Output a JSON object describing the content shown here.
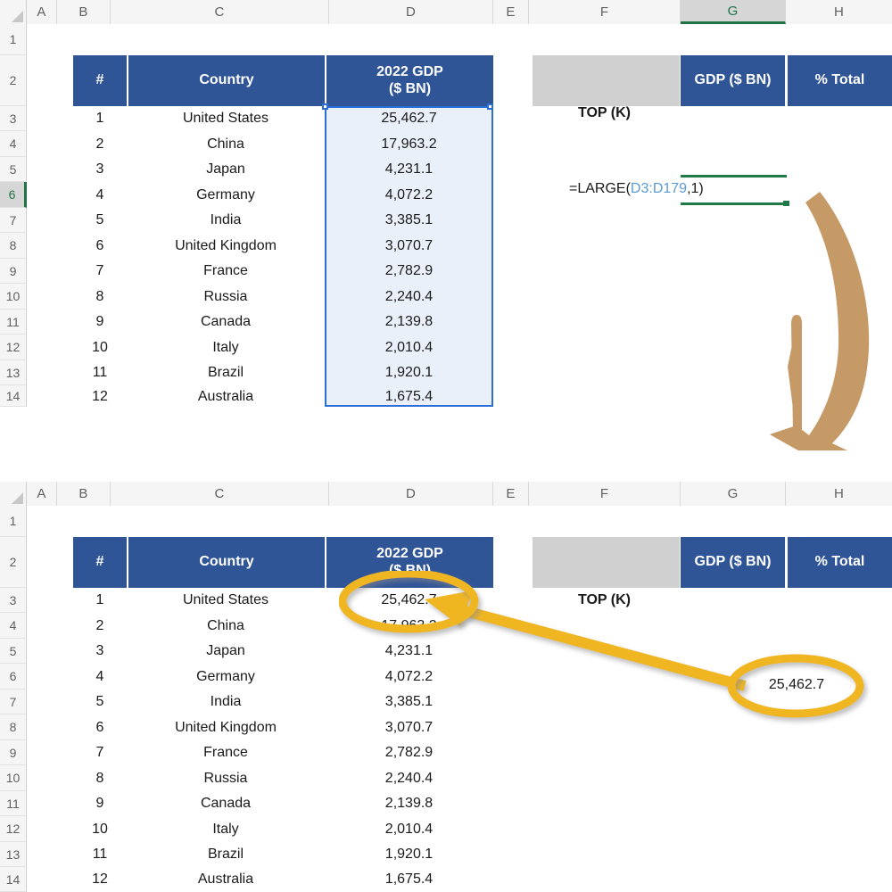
{
  "app": {
    "type": "spreadsheet",
    "name": "excel-worksheet"
  },
  "colors": {
    "header_blue": "#2F5597",
    "gray_cell": "#D0D0D0",
    "selection_blue": "#2B6FD6",
    "selection_fill": "#DDE7F7",
    "excel_green": "#217346",
    "formula_ref": "#5B9BD5",
    "annotation_yellow": "#F0B622",
    "annotation_tan": "#C59A67"
  },
  "columns": [
    "A",
    "B",
    "C",
    "D",
    "E",
    "F",
    "G",
    "H"
  ],
  "rows": [
    "1",
    "2",
    "3",
    "4",
    "5",
    "6",
    "7",
    "8",
    "9",
    "10",
    "11",
    "12",
    "13",
    "14"
  ],
  "top_panel": {
    "selected_column": "G",
    "selected_row": "6",
    "table": {
      "headers": [
        "#",
        "Country",
        "2022 GDP\n($ BN)"
      ],
      "header_line1": "2022 GDP",
      "header_line2": "($ BN)",
      "header_rank": "#",
      "header_country": "Country",
      "rows": [
        {
          "rank": "1",
          "country": "United States",
          "gdp": "25,462.7"
        },
        {
          "rank": "2",
          "country": "China",
          "gdp": "17,963.2"
        },
        {
          "rank": "3",
          "country": "Japan",
          "gdp": "4,231.1"
        },
        {
          "rank": "4",
          "country": "Germany",
          "gdp": "4,072.2"
        },
        {
          "rank": "5",
          "country": "India",
          "gdp": "3,385.1"
        },
        {
          "rank": "6",
          "country": "United Kingdom",
          "gdp": "3,070.7"
        },
        {
          "rank": "7",
          "country": "France",
          "gdp": "2,782.9"
        },
        {
          "rank": "8",
          "country": "Russia",
          "gdp": "2,240.4"
        },
        {
          "rank": "9",
          "country": "Canada",
          "gdp": "2,139.8"
        },
        {
          "rank": "10",
          "country": "Italy",
          "gdp": "2,010.4"
        },
        {
          "rank": "11",
          "country": "Brazil",
          "gdp": "1,920.1"
        },
        {
          "rank": "12",
          "country": "Australia",
          "gdp": "1,675.4"
        }
      ]
    },
    "side_table": {
      "blank_header": "",
      "gdp_header": "GDP ($ BN)",
      "pct_header": "% Total",
      "top_k_label": "TOP (K)"
    },
    "formula": {
      "prefix": "=LARGE(",
      "reference": "D3:D179",
      "suffix": ",1)",
      "full": "=LARGE(D3:D179,1)",
      "cell": "G6"
    },
    "selected_range": "D3:D179"
  },
  "bottom_panel": {
    "selected_column": "",
    "selected_row": "",
    "table": {
      "header_rank": "#",
      "header_country": "Country",
      "header_line1": "2022 GDP",
      "header_line2": "($ BN)",
      "rows": [
        {
          "rank": "1",
          "country": "United States",
          "gdp": "25,462.7"
        },
        {
          "rank": "2",
          "country": "China",
          "gdp": "17,963.2"
        },
        {
          "rank": "3",
          "country": "Japan",
          "gdp": "4,231.1"
        },
        {
          "rank": "4",
          "country": "Germany",
          "gdp": "4,072.2"
        },
        {
          "rank": "5",
          "country": "India",
          "gdp": "3,385.1"
        },
        {
          "rank": "6",
          "country": "United Kingdom",
          "gdp": "3,070.7"
        },
        {
          "rank": "7",
          "country": "France",
          "gdp": "2,782.9"
        },
        {
          "rank": "8",
          "country": "Russia",
          "gdp": "2,240.4"
        },
        {
          "rank": "9",
          "country": "Canada",
          "gdp": "2,139.8"
        },
        {
          "rank": "10",
          "country": "Italy",
          "gdp": "2,010.4"
        },
        {
          "rank": "11",
          "country": "Brazil",
          "gdp": "1,920.1"
        },
        {
          "rank": "12",
          "country": "Australia",
          "gdp": "1,675.4"
        }
      ]
    },
    "side_table": {
      "blank_header": "",
      "gdp_header": "GDP ($ BN)",
      "pct_header": "% Total",
      "top_k_label": "TOP (K)"
    },
    "result_value": "25,462.7",
    "highlighted_source_value": "25,462.7"
  },
  "annotations": {
    "tan_arrow": {
      "icon": "curved-down-arrow-icon",
      "direction": "down-left"
    },
    "yellow_arrow": {
      "icon": "straight-left-arrow-icon",
      "direction": "up-left"
    },
    "ellipse_result": {
      "icon": "ellipse-highlight-icon",
      "label": "25,462.7"
    },
    "ellipse_source": {
      "icon": "ellipse-highlight-icon",
      "label": "25,462.7"
    }
  }
}
